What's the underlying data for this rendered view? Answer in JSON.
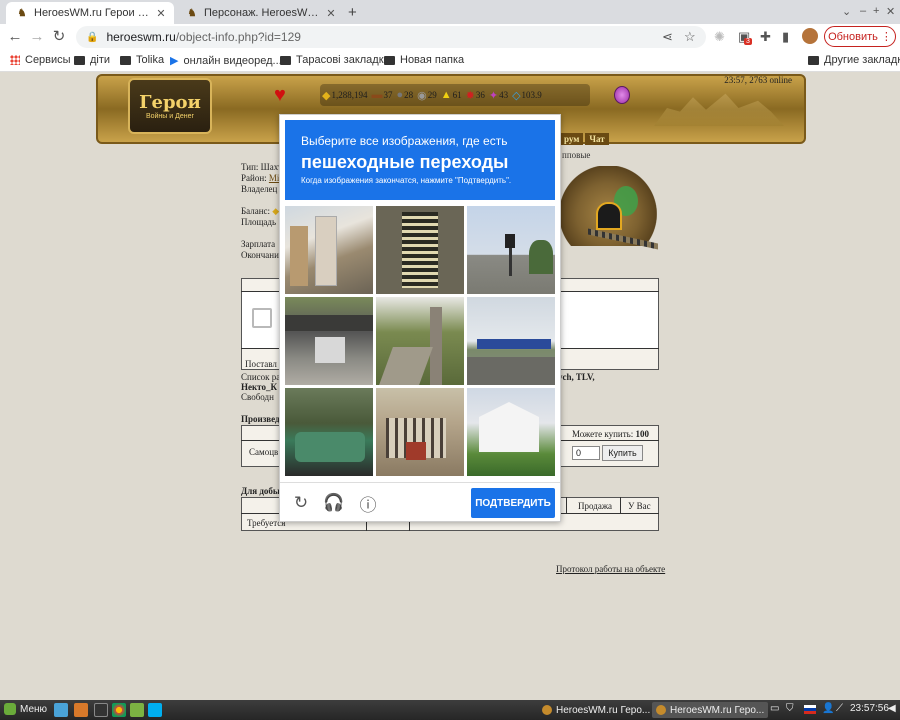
{
  "browser": {
    "tabs": [
      {
        "title": "HeroesWM.ru Герои войны и Деньги",
        "active": true
      },
      {
        "title": "Персонаж. HeroesWM.ru Герои войны и Деньги",
        "active": false
      }
    ],
    "new_tab": "+",
    "url_domain": "heroeswm.ru",
    "url_path": "/object-info.php?id=129",
    "update_button": "Обновить",
    "extension_badge": "3",
    "bookmarks": [
      "Сервисы",
      "діти",
      "Tolika",
      "онлайн видеоред...",
      "Тарасові закладки",
      "Новая папка"
    ],
    "other_bookmarks": "Другие закладки"
  },
  "game": {
    "logo_title": "Герои",
    "logo_sub": "Войны и Денег",
    "resources": [
      {
        "icon": "gold-icon",
        "glyph": "◆",
        "value": "1,288,194"
      },
      {
        "icon": "wood-icon",
        "glyph": "▬",
        "value": "37"
      },
      {
        "icon": "ore-icon",
        "glyph": "●",
        "value": "28"
      },
      {
        "icon": "mercury-icon",
        "glyph": "◉",
        "value": "29"
      },
      {
        "icon": "sulfur-icon",
        "glyph": "▲",
        "value": "61"
      },
      {
        "icon": "crystal-icon",
        "glyph": "✸",
        "value": "36"
      },
      {
        "icon": "gems-icon",
        "glyph": "✦",
        "value": "43"
      },
      {
        "icon": "diamond-icon",
        "glyph": "◇",
        "value": "103.9"
      }
    ],
    "time_online": "23:57, 2763 online",
    "nav_links": [
      "рум",
      "Чат"
    ],
    "info_lines": [
      {
        "label": "Тип: ",
        "value": "Шахт"
      },
      {
        "label": "Район: ",
        "value": "Mi"
      },
      {
        "label": "Владелец",
        "value": ""
      },
      {
        "label": "",
        "value": ""
      },
      {
        "label": "Баланс: ",
        "value": ""
      },
      {
        "label": "Площадь",
        "value": ""
      },
      {
        "label": "",
        "value": ""
      },
      {
        "label": "Зарплата",
        "value": ""
      },
      {
        "label": "Окончани",
        "value": ""
      }
    ],
    "hint_top": "пповые",
    "supplied_label": "Поставл",
    "workers_list_label": "Список ра",
    "workers_names": "ych, TLV,",
    "worker_second": "Некто_К",
    "free_label": "Свободн",
    "production_label": "Произвед",
    "product_row_label": "Самоцв",
    "can_buy_label": "Можете купить: ",
    "can_buy_value": "100",
    "qty_value": "0",
    "buy_button": "Купить",
    "mining_label": "Для добы",
    "columns_right": [
      "Продажа",
      "У Вас"
    ],
    "required_label": "Требуется",
    "protocol_link": "Протокол работы на объекте"
  },
  "captcha": {
    "line1": "Выберите все изображения, где есть",
    "line2": "пешеходные переходы",
    "line3": "Когда изображения закончатся, нажмите \"Подтвердить\".",
    "verify_button": "ПОДТВЕРДИТЬ"
  },
  "taskbar": {
    "menu": "Меню",
    "items": [
      {
        "title": "HeroesWM.ru Геро...",
        "active": false
      },
      {
        "title": "HeroesWM.ru Геро...",
        "active": true
      }
    ],
    "clock": "23:57:56"
  }
}
